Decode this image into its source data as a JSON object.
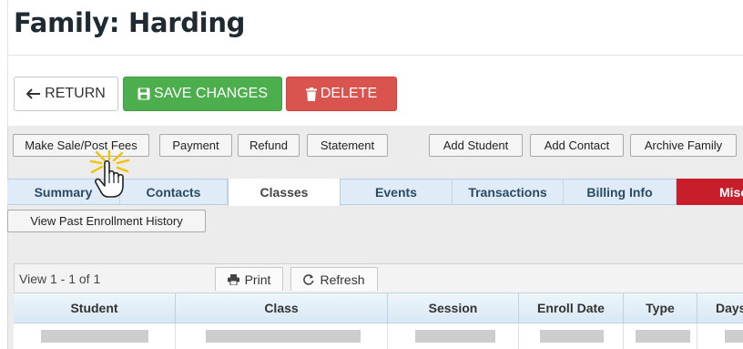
{
  "page": {
    "title": "Family: Harding"
  },
  "toolbar": {
    "return_label": "RETURN",
    "save_label": "SAVE CHANGES",
    "delete_label": "DELETE",
    "colors": {
      "save": "#4cae4c",
      "delete": "#d9534f"
    }
  },
  "actions": {
    "make_sale": "Make Sale/Post Fees",
    "payment": "Payment",
    "refund": "Refund",
    "statement": "Statement",
    "add_student": "Add Student",
    "add_contact": "Add Contact",
    "archive_family": "Archive Family"
  },
  "tabs": {
    "summary": "Summary",
    "contacts": "Contacts",
    "classes": "Classes",
    "events": "Events",
    "transactions": "Transactions",
    "billing_info": "Billing Info",
    "misc": "Misc",
    "active": "Classes",
    "misc_color": "#c81e2c"
  },
  "classes_panel": {
    "history_button": "View Past Enrollment History",
    "view_count": "View 1 - 1 of 1",
    "print_label": "Print",
    "refresh_label": "Refresh",
    "columns": [
      "Student",
      "Class",
      "Session",
      "Enroll Date",
      "Type",
      "Days"
    ]
  },
  "icons": {
    "return": "arrow-left-icon",
    "save": "floppy-disk-icon",
    "delete": "trash-icon",
    "print": "printer-icon",
    "refresh": "refresh-icon",
    "cursor": "hand-pointer-icon"
  }
}
